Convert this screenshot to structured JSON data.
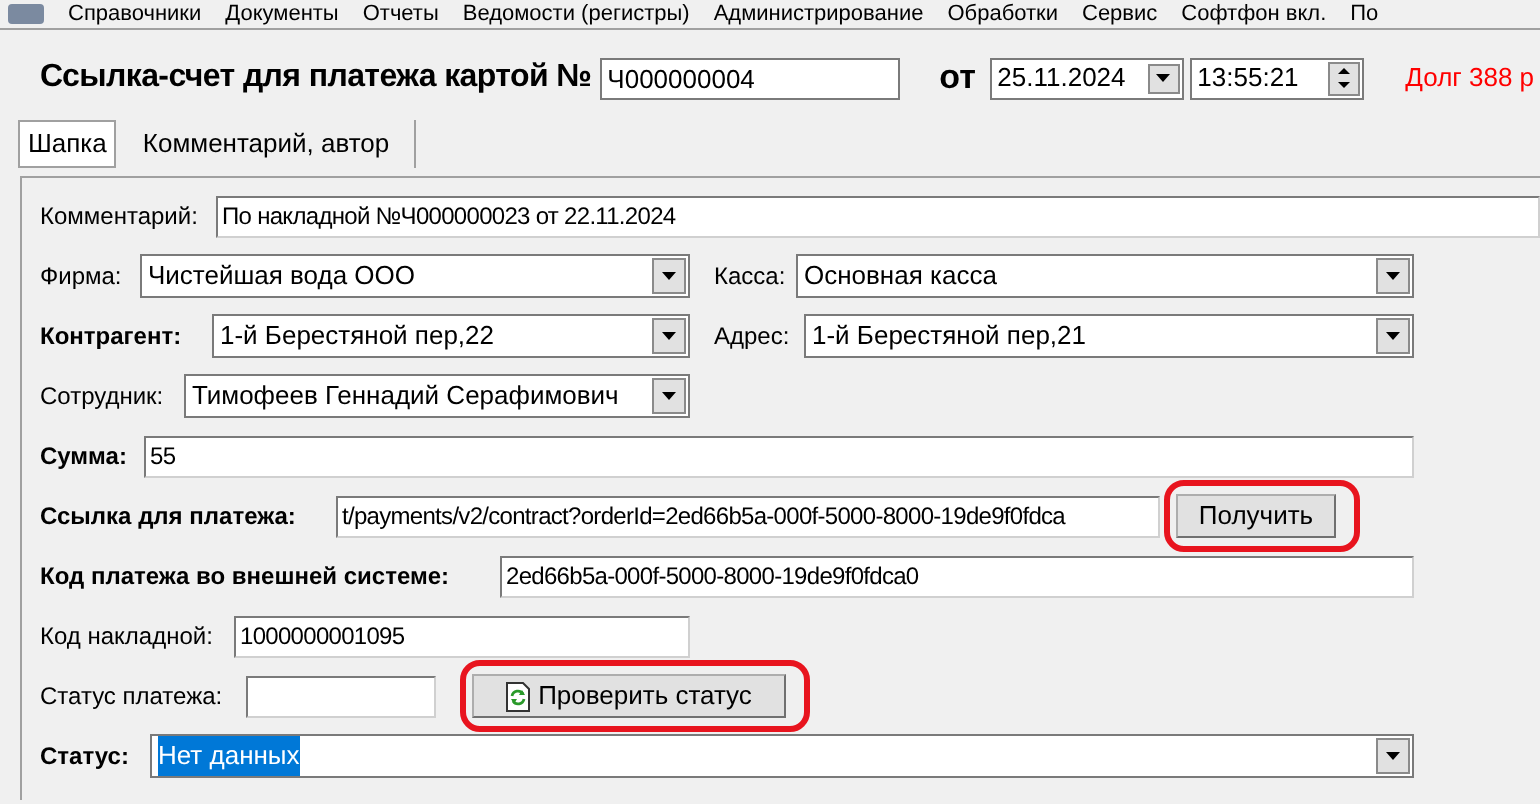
{
  "menu": [
    "Справочники",
    "Документы",
    "Отчеты",
    "Ведомости (регистры)",
    "Администрирование",
    "Обработки",
    "Сервис",
    "Софтфон вкл.",
    "По"
  ],
  "header": {
    "title": "Ссылка-счет для платежа картой №",
    "number": "Ч000000004",
    "date_label": "от",
    "date": "25.11.2024",
    "time": "13:55:21",
    "debt": "Долг 388 р"
  },
  "tabs": [
    {
      "label": "Шапка",
      "selected": true
    },
    {
      "label": "Комментарий, автор",
      "selected": false
    }
  ],
  "rows": [
    {
      "items": [
        {
          "kind": "text",
          "label": "Комментарий:",
          "bold": false,
          "value": "По накладной №Ч000000023 от 22.11.2024"
        }
      ]
    },
    {
      "items": [
        {
          "kind": "combo",
          "label": "Фирма:",
          "bold": false,
          "value": "Чистейшая вода ООО"
        },
        {
          "kind": "combo",
          "label": "Касса:",
          "bold": false,
          "value": "Основная касса"
        }
      ]
    },
    {
      "items": [
        {
          "kind": "combo",
          "label": "Контрагент:",
          "bold": true,
          "value": "1-й Берестяной пер,22"
        },
        {
          "kind": "combo",
          "label": "Адрес:",
          "bold": false,
          "value": "1-й Берестяной пер,21"
        }
      ]
    },
    {
      "items": [
        {
          "kind": "combo",
          "label": "Сотрудник:",
          "bold": false,
          "value": "Тимофеев Геннадий Серафимович"
        }
      ]
    },
    {
      "items": [
        {
          "kind": "text",
          "label": "Сумма:",
          "bold": true,
          "value": "55"
        }
      ]
    },
    {
      "items": [
        {
          "kind": "text",
          "label": "Ссылка для платежа:",
          "bold": true,
          "value": "t/payments/v2/contract?orderId=2ed66b5a-000f-5000-8000-19de9f0fdca"
        },
        {
          "kind": "button",
          "label": "Получить",
          "circled": true
        }
      ]
    },
    {
      "items": [
        {
          "kind": "text",
          "label": "Код платежа во внешней системе:",
          "bold": true,
          "value": "2ed66b5a-000f-5000-8000-19de9f0fdca0"
        }
      ]
    },
    {
      "items": [
        {
          "kind": "text",
          "label": "Код накладной:",
          "bold": false,
          "value": "1000000001095"
        }
      ]
    },
    {
      "items": [
        {
          "kind": "text",
          "label": "Статус платежа:",
          "bold": false
        },
        {
          "kind": "icon_button",
          "label": "Проверить статус",
          "circled": true
        }
      ]
    },
    {
      "items": [
        {
          "kind": "combo",
          "label": "Статус:",
          "bold": true,
          "value": "Нет данных",
          "value_selected": true
        }
      ]
    }
  ]
}
